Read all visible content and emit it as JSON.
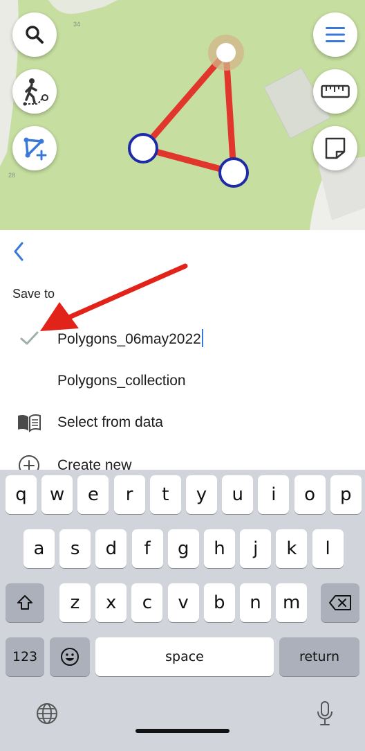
{
  "map": {
    "labels": [
      "34",
      "28"
    ],
    "buttons": {
      "search": "search-icon",
      "track": "walking-track-icon",
      "add_polygon": "add-polygon-icon",
      "menu": "hamburger-menu-icon",
      "measure": "ruler-icon",
      "layers": "layers-icon"
    }
  },
  "sheet": {
    "back_icon": "chevron-left-icon",
    "save_to_label": "Save to",
    "selected_layer": "Polygons_06may2022",
    "other_layer": "Polygons_collection",
    "select_from_data": "Select from data",
    "create_new": "Create new"
  },
  "keyboard": {
    "row1": [
      "q",
      "w",
      "e",
      "r",
      "t",
      "y",
      "u",
      "i",
      "o",
      "p"
    ],
    "row2": [
      "a",
      "s",
      "d",
      "f",
      "g",
      "h",
      "j",
      "k",
      "l"
    ],
    "row3": [
      "z",
      "x",
      "c",
      "v",
      "b",
      "n",
      "m"
    ],
    "numbers_key": "123",
    "space_key": "space",
    "return_key": "return"
  },
  "colors": {
    "accent": "#3a78d8",
    "polygon_line": "#e0362c",
    "vertex_stroke": "#1f2aa8",
    "annotation_arrow": "#e2231a",
    "map_green": "#c6dea0"
  }
}
